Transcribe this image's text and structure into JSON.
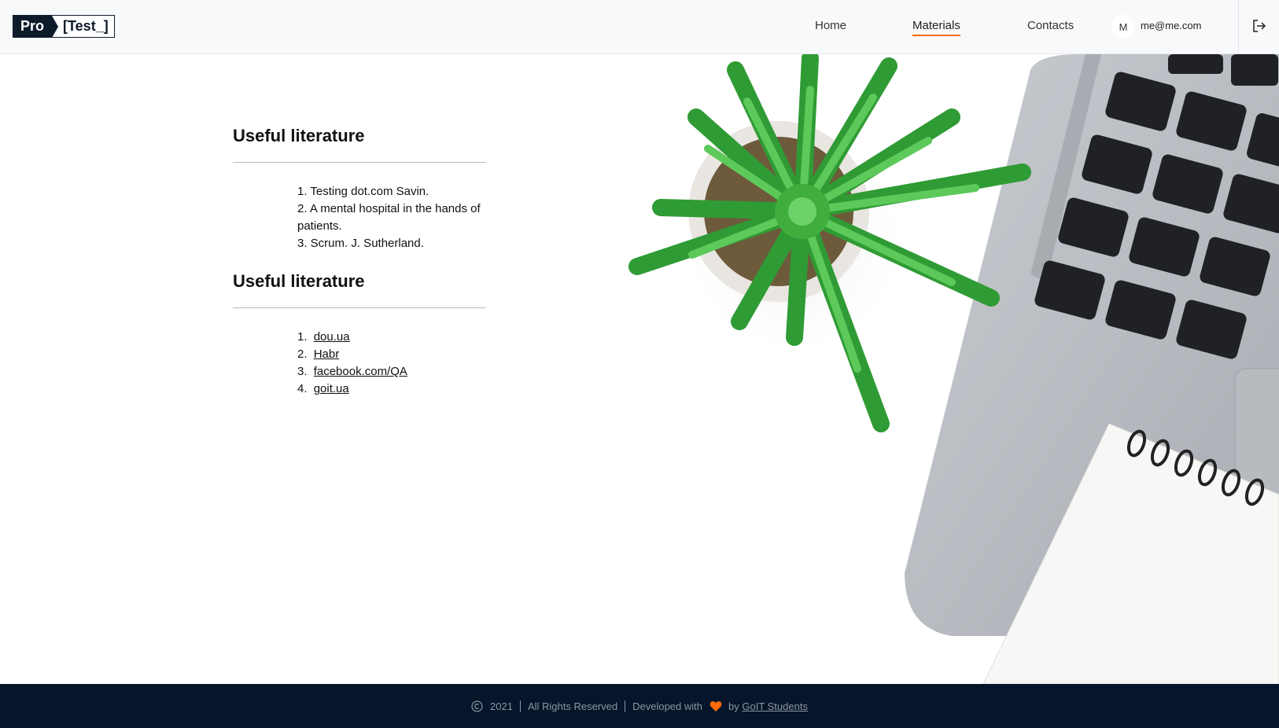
{
  "header": {
    "logo": {
      "pro": "Pro",
      "test": "[Test_]"
    },
    "nav": [
      {
        "label": "Home",
        "active": false
      },
      {
        "label": "Materials",
        "active": true
      },
      {
        "label": "Contacts",
        "active": false
      }
    ],
    "user": {
      "avatar_letter": "M",
      "email": "me@me.com"
    },
    "accent_color": "#ff6b08"
  },
  "main": {
    "sections": [
      {
        "title": "Useful literature",
        "items": [
          "1. Testing dot.com Savin.",
          "2. A mental hospital in the hands of patients.",
          "3. Scrum. J. Sutherland."
        ]
      },
      {
        "title": "Useful literature",
        "links": [
          {
            "num": "1.",
            "label": "dou.ua"
          },
          {
            "num": "2.",
            "label": "Habr"
          },
          {
            "num": "3.",
            "label": "facebook.com/QA"
          },
          {
            "num": "4.",
            "label": "goit.ua"
          }
        ]
      }
    ]
  },
  "footer": {
    "year": "2021",
    "rights": "All Rights Reserved",
    "developed": "Developed with",
    "by": "by",
    "author": "GoIT Students",
    "heart_color": "#ff6b08",
    "bg_color": "#06152a"
  }
}
